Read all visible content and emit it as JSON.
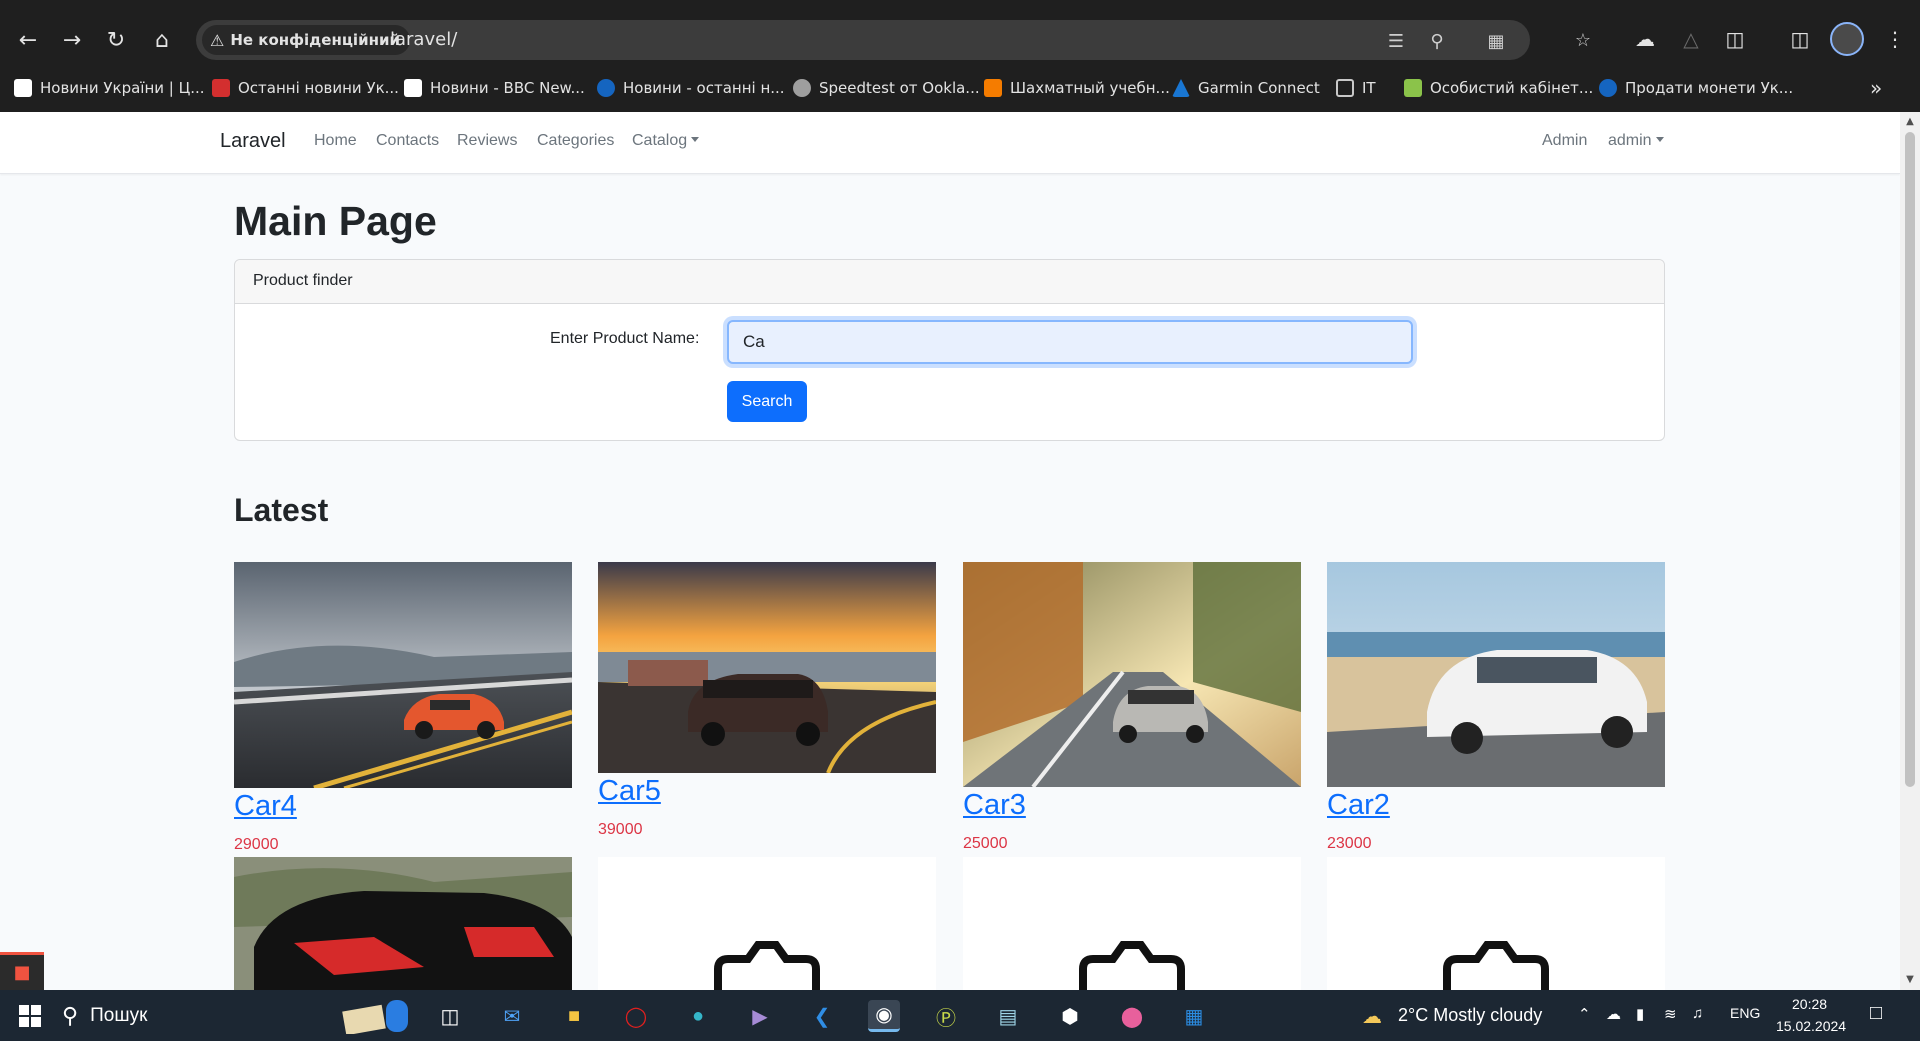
{
  "browser": {
    "security_label": "Не конфіденційний",
    "url": "laravel/",
    "bookmarks": [
      {
        "label": "Новини України | Ц...",
        "color": "#ffffff"
      },
      {
        "label": "Останні новини Ук...",
        "color": "#d32f2f"
      },
      {
        "label": "Новини - BBC New...",
        "color": "#ffffff"
      },
      {
        "label": "Новини - останні н...",
        "color": "#1565c0"
      },
      {
        "label": "Speedtest от Ookla...",
        "color": "#9e9e9e"
      },
      {
        "label": "Шахматный учебн...",
        "color": "#f57c00"
      },
      {
        "label": "Garmin Connect",
        "color": "#1976d2"
      },
      {
        "label": "IT",
        "color": "#9e9e9e"
      },
      {
        "label": "Особистий кабінет...",
        "color": "#8bc34a"
      },
      {
        "label": "Продати монети Ук...",
        "color": "#1565c0"
      }
    ]
  },
  "navbar": {
    "brand": "Laravel",
    "links": [
      "Home",
      "Contacts",
      "Reviews",
      "Categories",
      "Catalog"
    ],
    "admin": "Admin",
    "user": "admin"
  },
  "main": {
    "title": "Main Page",
    "finder": {
      "header": "Product finder",
      "label": "Enter Product Name:",
      "value": "Ca",
      "button": "Search"
    },
    "latest_title": "Latest",
    "products": [
      {
        "name": "Car4",
        "price": "29000"
      },
      {
        "name": "Car5",
        "price": "39000"
      },
      {
        "name": "Car3",
        "price": "25000"
      },
      {
        "name": "Car2",
        "price": "23000"
      }
    ]
  },
  "taskbar": {
    "search": "Пошук",
    "weather": "2°C  Mostly cloudy",
    "lang": "ENG",
    "time": "20:28",
    "date": "15.02.2024"
  },
  "colors": {
    "link": "#0d6efd",
    "price": "#dc3545",
    "button": "#0d6efd"
  }
}
